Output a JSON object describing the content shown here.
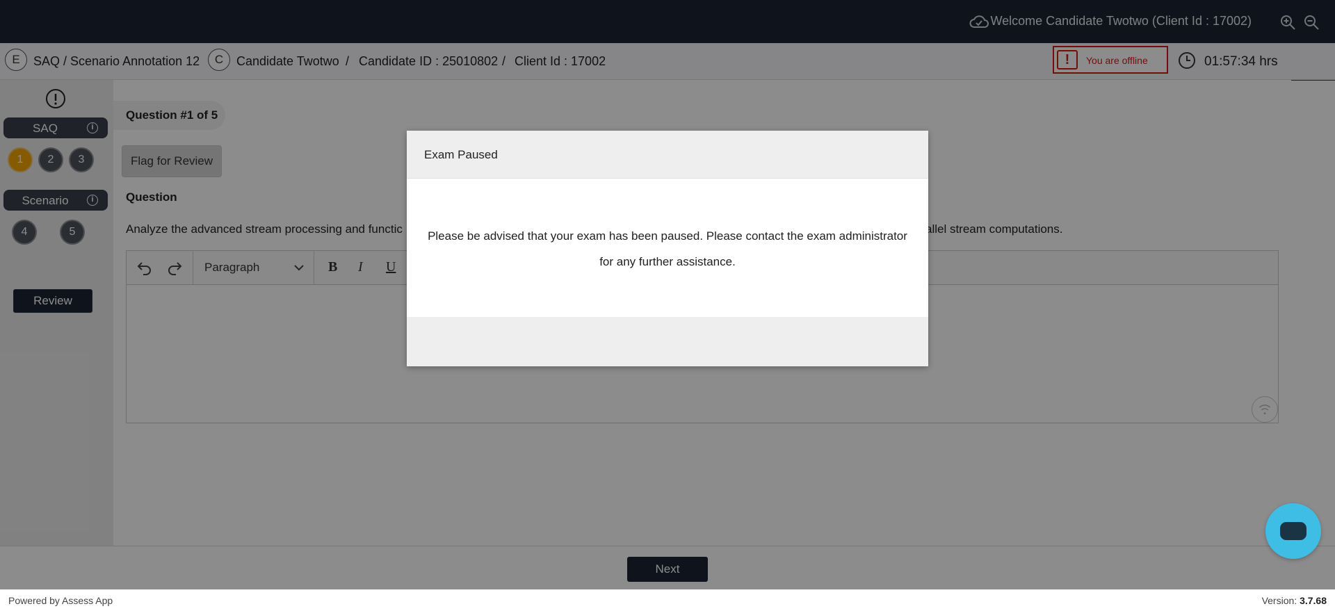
{
  "header": {
    "welcome_text": "Welcome Candidate Twotwo (Client Id : 17002)",
    "icons": [
      "cloud-sync-icon",
      "zoom-in-icon",
      "zoom-out-icon"
    ]
  },
  "subheader": {
    "exam_initial": "E",
    "exam_name": "SAQ / Scenario Annotation 12",
    "candidate_initial": "C",
    "candidate_name": "Candidate Twotwo",
    "separator": "/",
    "candidate_id": "Candidate ID : 25010802",
    "client_id": "Client Id : 17002",
    "offline_status": "You are offline",
    "offline_icon": "!",
    "time_remaining": "01:57:34 hrs"
  },
  "sidebar": {
    "sections": [
      {
        "label": "SAQ",
        "questions": [
          "1",
          "2",
          "3"
        ]
      },
      {
        "label": "Scenario",
        "questions": [
          "4",
          "5"
        ]
      }
    ],
    "info_glyph": "i",
    "active_question": "1",
    "review_label": "Review"
  },
  "question": {
    "tab_label": "Question #1 of 5",
    "flag_label": "Flag for Review",
    "heading": "Question",
    "text_start": "Analyze the advanced stream processing and functic",
    "text_end": "allel stream computations."
  },
  "editor": {
    "block_format": "Paragraph",
    "format_buttons": [
      "B",
      "I",
      "U"
    ]
  },
  "navigation": {
    "next_label": "Next"
  },
  "footer": {
    "powered_by": "Powered by Assess App",
    "version_label": "Version: ",
    "version_number": "3.7.68"
  },
  "modal": {
    "title": "Exam Paused",
    "message_line1": "Please be advised that your exam has been paused. Please contact the exam administrator",
    "message_line2": "for any further assistance."
  },
  "colors": {
    "topbar": "#1c2434",
    "active_question": "#f5a400",
    "offline": "#d11a1a",
    "chat_button": "#3ebde5"
  }
}
